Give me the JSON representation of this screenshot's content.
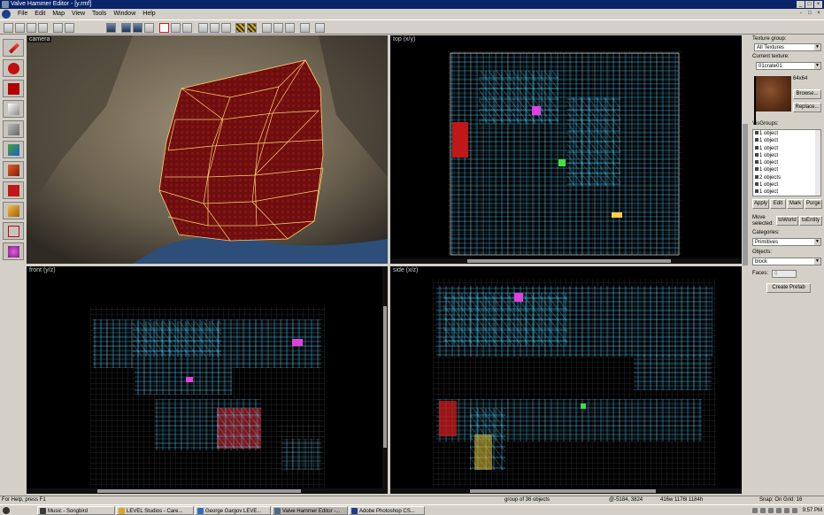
{
  "window": {
    "title": "Valve Hammer Editor - [y.rmf]",
    "controls": [
      "_",
      "□",
      "×"
    ]
  },
  "menu": [
    "File",
    "Edit",
    "Map",
    "View",
    "Tools",
    "Window",
    "Help"
  ],
  "mdi_controls": [
    "-",
    "□",
    "×"
  ],
  "left_tools": [
    "selection-tool",
    "magnify-tool",
    "camera-tool",
    "entity-tool",
    "block-tool",
    "texture-tool",
    "apply-texture-tool",
    "decal-tool",
    "clipping-tool",
    "vertex-manipulation-tool",
    "path-tool"
  ],
  "viewports": {
    "camera": {
      "label": "camera"
    },
    "top": {
      "label": "top (x/y)"
    },
    "front": {
      "label": "front (y/z)"
    },
    "side": {
      "label": "side (x/z)"
    }
  },
  "panel": {
    "texture_group_label": "Texture group:",
    "texture_group_value": "All Textures",
    "current_texture_label": "Current texture:",
    "current_texture_value": "01crate01",
    "texture_size": "64x64",
    "browse_button": "Browse...",
    "replace_button": "Replace...",
    "visgroups_label": "VisGroups:",
    "visgroups": [
      "1 object",
      "1 object",
      "1 object",
      "1 object",
      "1 object",
      "1 object",
      "2 objects",
      "1 object",
      "1 object"
    ],
    "apply_button": "Apply",
    "edit_button": "Edit",
    "mark_button": "Mark",
    "purge_button": "Purge",
    "move_selected_label": "Move selected:",
    "to_world_button": "toWorld",
    "to_entity_button": "toEntity",
    "categories_label": "Categories:",
    "categories_value": "Primitives",
    "objects_label": "Objects:",
    "objects_value": "block",
    "faces_label": "Faces:",
    "faces_value": "0",
    "create_prefab_button": "Create Prefab"
  },
  "status": {
    "help": "For Help, press F1",
    "selection": "group of 36 objects",
    "coords": "@-5184, 3824",
    "dims": "416w 1176l 1184h",
    "snap": "Snap: On Grid: 16"
  },
  "taskbar": {
    "start_label": "Start",
    "tasks": [
      {
        "label": "Music - Songbird",
        "color": "#3a3a3a"
      },
      {
        "label": "LEVEL Studios - Care...",
        "color": "#d9a520"
      },
      {
        "label": "George Gargov LEVE...",
        "color": "#2a6fbf"
      },
      {
        "label": "Valve Hammer Editor -...",
        "color": "#4a6a8a"
      },
      {
        "label": "Adobe Photoshop CS...",
        "color": "#1c3c8c"
      }
    ],
    "clock": "9:57 PM"
  },
  "colors": {
    "title_bar": "#0a246a",
    "wireframe_cyan": "#3ec8ff",
    "wireframe_grid": "#808080",
    "brush_red": "#7a1010",
    "brush_edge": "#ffd070"
  }
}
